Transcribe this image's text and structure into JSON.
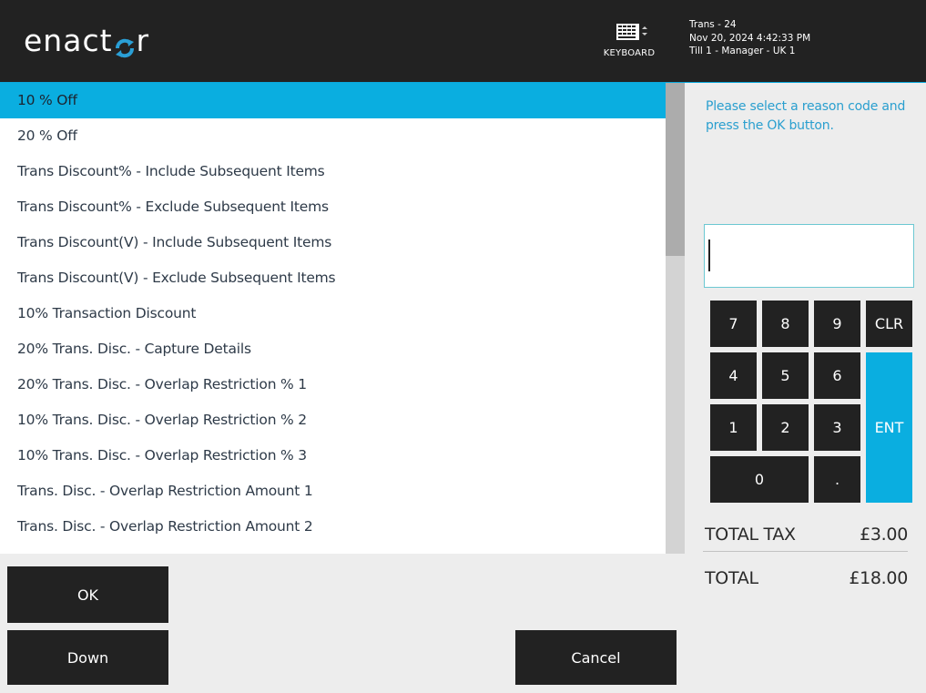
{
  "header": {
    "logo_text_left": "enact",
    "logo_text_right": "r",
    "keyboard_label": "KEYBOARD",
    "trans_number": "Trans - 24",
    "datetime": "Nov 20, 2024 4:42:33 PM",
    "terminal": "Till 1 - Manager - UK 1"
  },
  "reason_list": {
    "selected_index": 0,
    "items": [
      "10 % Off",
      "20 % Off",
      "Trans Discount% - Include Subsequent Items",
      "Trans Discount% - Exclude Subsequent Items",
      "Trans Discount(V) - Include Subsequent Items",
      "Trans Discount(V) - Exclude Subsequent Items",
      "10% Transaction Discount",
      "20% Trans. Disc. - Capture Details",
      "20% Trans. Disc. - Overlap Restriction % 1",
      "10% Trans. Disc. - Overlap Restriction % 2",
      "10% Trans. Disc. - Overlap Restriction % 3",
      "Trans. Disc. - Overlap Restriction Amount 1",
      "Trans. Disc. - Overlap Restriction Amount 2"
    ]
  },
  "panel": {
    "prompt": "Please select a reason code and press the OK button.",
    "input_value": ""
  },
  "keypad": {
    "k7": "7",
    "k8": "8",
    "k9": "9",
    "clr": "CLR",
    "k4": "4",
    "k5": "5",
    "k6": "6",
    "k1": "1",
    "k2": "2",
    "k3": "3",
    "ent": "ENT",
    "k0": "0",
    "dot": "."
  },
  "totals": {
    "tax_label": "TOTAL TAX",
    "tax_value": "£3.00",
    "total_label": "TOTAL",
    "total_value": "£18.00"
  },
  "buttons": {
    "ok": "OK",
    "down": "Down",
    "cancel": "Cancel"
  },
  "colors": {
    "accent": "#0aaee0",
    "header_bg": "#222222",
    "button_bg": "#222222",
    "prompt_text": "#2a9fcf"
  }
}
